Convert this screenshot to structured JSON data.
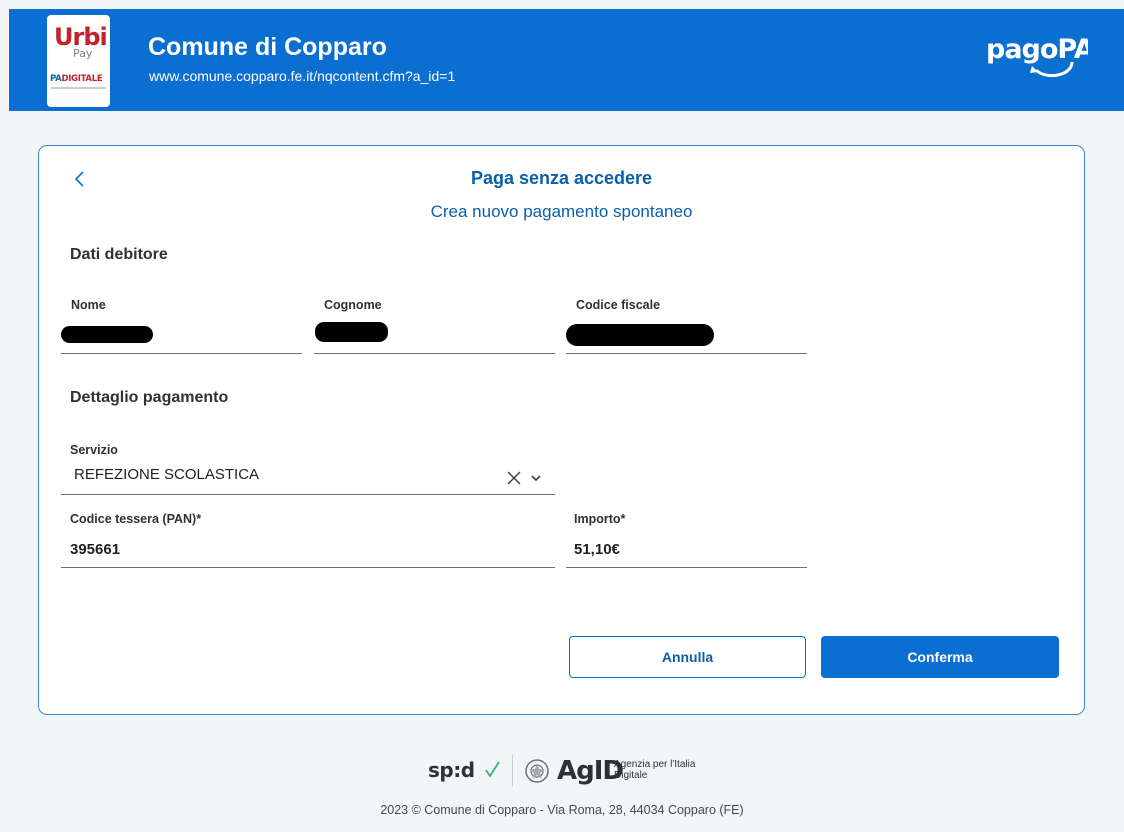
{
  "header": {
    "logo_urbi": "Urbi",
    "logo_pay": "Pay",
    "logo_padigitale_pa": "PA",
    "logo_padigitale_rest": "DIGITALE",
    "title": "Comune di Copparo",
    "url": "www.comune.copparo.fe.it/nqcontent.cfm?a_id=1",
    "pagopa_logo_text": "pagoPA"
  },
  "card": {
    "title": "Paga senza accedere",
    "subtitle": "Crea nuovo pagamento spontaneo",
    "debtor_section_title": "Dati debitore",
    "debtor_fields": {
      "nome_label": "Nome",
      "cognome_label": "Cognome",
      "codice_fiscale_label": "Codice fiscale"
    },
    "payment_section_title": "Dettaglio pagamento",
    "servizio": {
      "label": "Servizio",
      "value": "REFEZIONE SCOLASTICA"
    },
    "codice_tessera": {
      "label": "Codice tessera (PAN)*",
      "value": "395661"
    },
    "importo": {
      "label": "Importo*",
      "value": "51,10€"
    },
    "buttons": {
      "cancel": "Annulla",
      "confirm": "Conferma"
    }
  },
  "footer": {
    "spid_text": "sp:d",
    "agid_text": "AgID",
    "agid_subtitle": "Agenzia per l'Italia Digitale",
    "copyright": "2023 © Comune di Copparo - Via Roma, 28, 44034 Copparo (FE)"
  },
  "colors": {
    "brand_blue": "#0b6fd1",
    "title_blue": "#0b5fa8",
    "background": "#f4f5f7"
  }
}
